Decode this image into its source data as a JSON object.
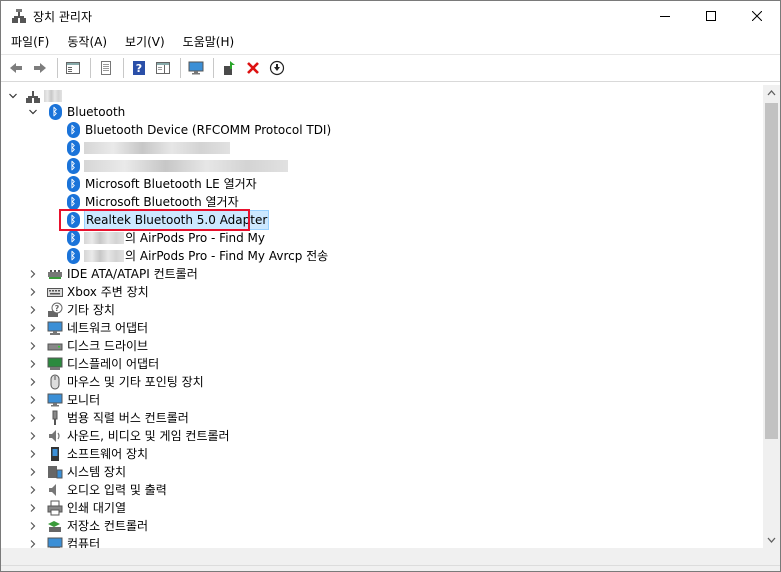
{
  "window": {
    "title": "장치 관리자"
  },
  "menu": [
    "파일(F)",
    "동작(A)",
    "보기(V)",
    "도움말(H)"
  ],
  "toolbar": [
    "back-icon",
    "forward-icon",
    "show-hide-console-tree-icon",
    "properties-icon",
    "help-icon",
    "action-pane-icon",
    "monitor-icon",
    "update-driver-icon",
    "uninstall-icon",
    "disable-icon"
  ],
  "tree": {
    "bluetooth_label": "Bluetooth",
    "bt_devices": [
      "Bluetooth Device (RFCOMM Protocol TDI)",
      "",
      "",
      "Microsoft Bluetooth LE 열거자",
      "Microsoft Bluetooth 열거자",
      "Realtek Bluetooth 5.0 Adapter",
      "의 AirPods Pro - Find My",
      "의 AirPods Pro - Find My Avrcp 전송"
    ],
    "categories": [
      "IDE ATA/ATAPI 컨트롤러",
      "Xbox 주변 장치",
      "기타 장치",
      "네트워크 어댑터",
      "디스크 드라이브",
      "디스플레이 어댑터",
      "마우스 및 기타 포인팅 장치",
      "모니터",
      "범용 직렬 버스 컨트롤러",
      "사운드, 비디오 및 게임 컨트롤러",
      "소프트웨어 장치",
      "시스템 장치",
      "오디오 입력 및 출력",
      "인쇄 대기열",
      "저장소 컨트롤러",
      "컴퓨터"
    ]
  },
  "colors": {
    "selection": "#cce8ff",
    "highlight_box": "#e8112d",
    "bluetooth": "#1a73d9"
  }
}
